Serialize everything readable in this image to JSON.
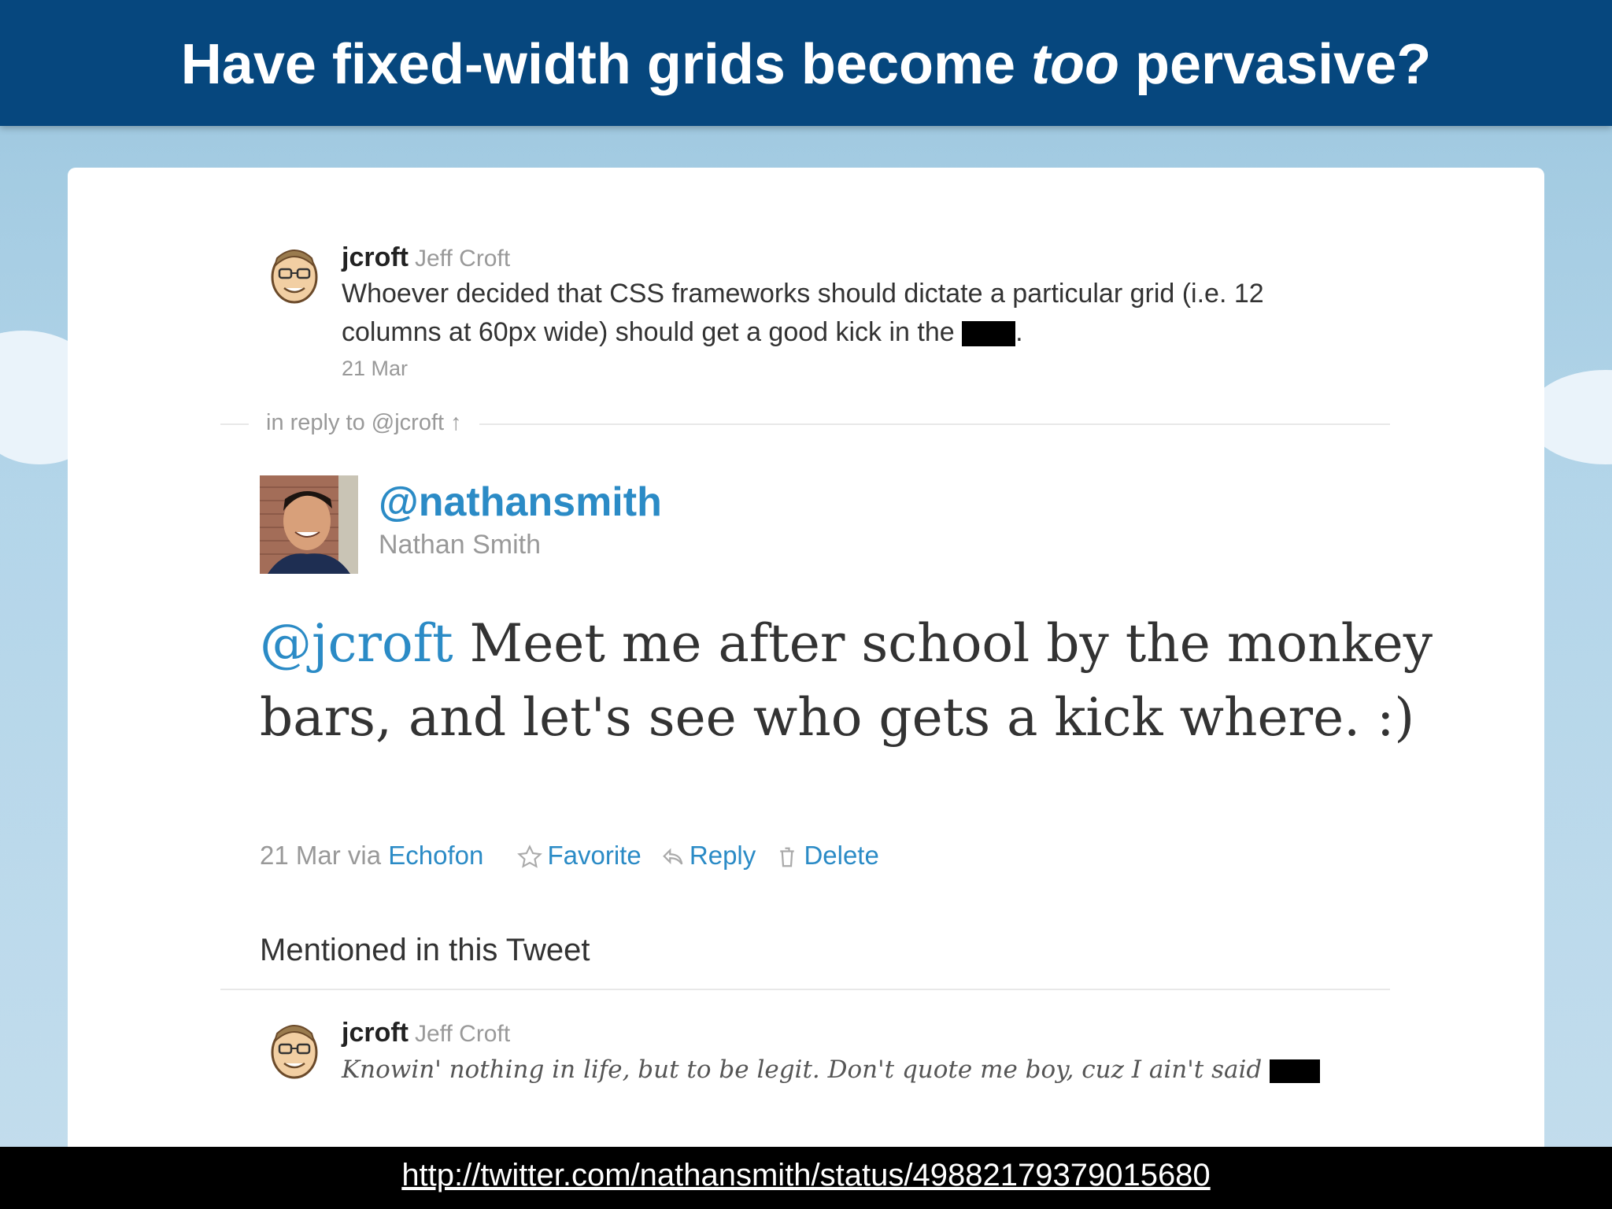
{
  "slide": {
    "title_before": "Have fixed-width grids become ",
    "title_emphasis": "too",
    "title_after": " pervasive?"
  },
  "original_tweet": {
    "username": "jcroft",
    "full_name": "Jeff Croft",
    "text": "Whoever decided that CSS frameworks should dictate a particular grid (i.e. 12 columns at 60px wide) should get a good kick in the",
    "text_end": ".",
    "date": "21 Mar"
  },
  "reply_label": "in reply to @jcroft ↑",
  "main_tweet": {
    "handle": "@nathansmith",
    "full_name": "Nathan Smith",
    "mention": "@jcroft",
    "text": " Meet me after school by the monkey bars, and let's see who gets a kick where. :)",
    "meta_prefix": "21 Mar via ",
    "client": "Echofon",
    "favorite_label": "Favorite",
    "reply_label": "Reply",
    "delete_label": "Delete"
  },
  "mentioned": {
    "title": "Mentioned in this Tweet",
    "username": "jcroft",
    "full_name": "Jeff Croft",
    "bio": "Knowin' nothing in life, but to be legit. Don't quote me boy, cuz I ain't said"
  },
  "footer": {
    "url": "http://twitter.com/nathansmith/status/49882179379015680"
  },
  "colors": {
    "header_blue": "#06477e",
    "link_blue": "#2b8bc6",
    "meta_gray": "#999999",
    "footer_black": "#000000"
  }
}
